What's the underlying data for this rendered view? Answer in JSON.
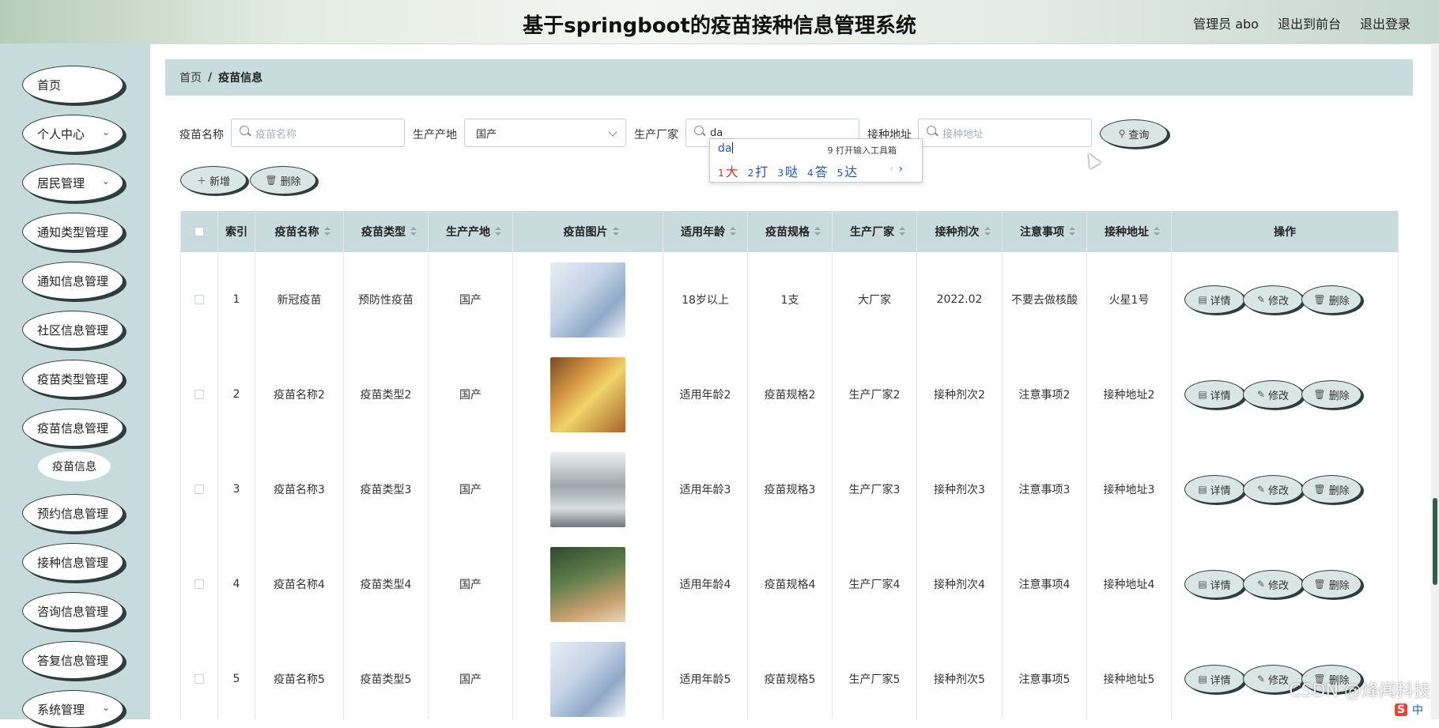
{
  "header": {
    "title": "基于springboot的疫苗接种信息管理系统",
    "user": "管理员 abo",
    "to_front": "退出到前台",
    "logout": "退出登录"
  },
  "sidebar": {
    "items": [
      {
        "label": "首页"
      },
      {
        "label": "个人中心"
      },
      {
        "label": "居民管理"
      },
      {
        "label": "通知类型管理"
      },
      {
        "label": "通知信息管理"
      },
      {
        "label": "社区信息管理"
      },
      {
        "label": "疫苗类型管理"
      },
      {
        "label": "疫苗信息管理"
      },
      {
        "label": "疫苗信息"
      },
      {
        "label": "预约信息管理"
      },
      {
        "label": "接种信息管理"
      },
      {
        "label": "咨询信息管理"
      },
      {
        "label": "答复信息管理"
      },
      {
        "label": "系统管理"
      }
    ]
  },
  "breadcrumb": {
    "home": "首页",
    "sep": "/",
    "current": "疫苗信息"
  },
  "search": {
    "name_label": "疫苗名称",
    "name_placeholder": "疫苗名称",
    "origin_label": "生产产地",
    "origin_value": "国产",
    "maker_label": "生产厂家",
    "maker_value": "da",
    "address_label": "接种地址",
    "address_placeholder": "接种地址",
    "query_button": "查询"
  },
  "ime": {
    "typed": "da",
    "hint": "9 打开输入工具箱",
    "candidates": [
      {
        "n": "1",
        "c": "大"
      },
      {
        "n": "2",
        "c": "打"
      },
      {
        "n": "3",
        "c": "哒"
      },
      {
        "n": "4",
        "c": "答"
      },
      {
        "n": "5",
        "c": "达"
      }
    ],
    "prev": "‹",
    "next": "›"
  },
  "toolbar": {
    "add": "新增",
    "delete": "删除"
  },
  "table": {
    "headers": [
      "索引",
      "疫苗名称",
      "疫苗类型",
      "生产产地",
      "疫苗图片",
      "适用年龄",
      "疫苗规格",
      "生产厂家",
      "接种剂次",
      "注意事项",
      "接种地址",
      "操作"
    ],
    "rows": [
      [
        "1",
        "新冠疫苗",
        "预防性疫苗",
        "国产",
        "",
        "18岁以上",
        "1支",
        "大厂家",
        "2022.02",
        "不要去做核酸",
        "火星1号"
      ],
      [
        "2",
        "疫苗名称2",
        "疫苗类型2",
        "国产",
        "",
        "适用年龄2",
        "疫苗规格2",
        "生产厂家2",
        "接种剂次2",
        "注意事项2",
        "接种地址2"
      ],
      [
        "3",
        "疫苗名称3",
        "疫苗类型3",
        "国产",
        "",
        "适用年龄3",
        "疫苗规格3",
        "生产厂家3",
        "接种剂次3",
        "注意事项3",
        "接种地址3"
      ],
      [
        "4",
        "疫苗名称4",
        "疫苗类型4",
        "国产",
        "",
        "适用年龄4",
        "疫苗规格4",
        "生产厂家4",
        "接种剂次4",
        "注意事项4",
        "接种地址4"
      ],
      [
        "5",
        "疫苗名称5",
        "疫苗类型5",
        "国产",
        "",
        "适用年龄5",
        "疫苗规格5",
        "生产厂家5",
        "接种剂次5",
        "注意事项5",
        "接种地址5"
      ]
    ],
    "actions": {
      "detail": "详情",
      "edit": "修改",
      "delete": "删除"
    }
  },
  "watermark": "CSDN @烽闻科技",
  "ime_status": "中"
}
